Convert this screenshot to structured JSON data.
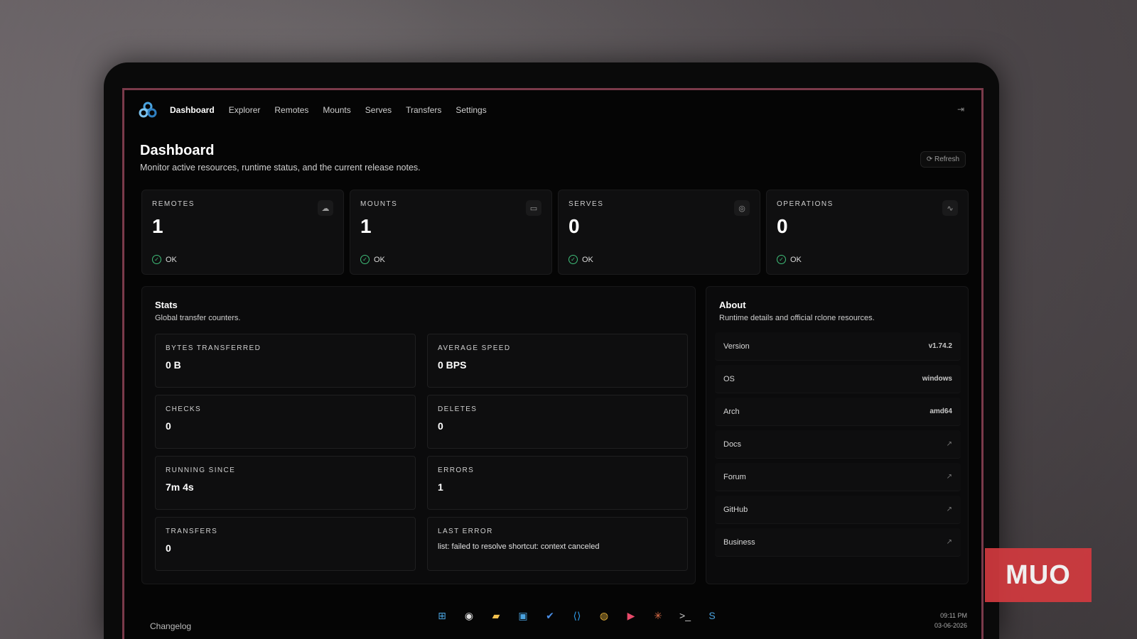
{
  "nav": {
    "items": [
      "Dashboard",
      "Explorer",
      "Remotes",
      "Mounts",
      "Serves",
      "Transfers",
      "Settings"
    ],
    "active": "Dashboard"
  },
  "header": {
    "title": "Dashboard",
    "subtitle": "Monitor active resources, runtime status, and the current release notes.",
    "refresh_label": "Refresh"
  },
  "cards": [
    {
      "label": "REMOTES",
      "value": "1",
      "status": "OK",
      "icon": "cloud-icon"
    },
    {
      "label": "MOUNTS",
      "value": "1",
      "status": "OK",
      "icon": "drive-icon"
    },
    {
      "label": "SERVES",
      "value": "0",
      "status": "OK",
      "icon": "globe-icon"
    },
    {
      "label": "OPERATIONS",
      "value": "0",
      "status": "OK",
      "icon": "activity-icon"
    }
  ],
  "stats": {
    "title": "Stats",
    "subtitle": "Global transfer counters.",
    "items": [
      {
        "label": "BYTES TRANSFERRED",
        "value": "0 B"
      },
      {
        "label": "AVERAGE SPEED",
        "value": "0 BPS"
      },
      {
        "label": "CHECKS",
        "value": "0"
      },
      {
        "label": "DELETES",
        "value": "0"
      },
      {
        "label": "RUNNING SINCE",
        "value": "7m 4s"
      },
      {
        "label": "ERRORS",
        "value": "1"
      },
      {
        "label": "TRANSFERS",
        "value": "0"
      },
      {
        "label": "LAST ERROR",
        "value": "list: failed to resolve shortcut: context canceled"
      }
    ]
  },
  "about": {
    "title": "About",
    "subtitle": "Runtime details and official rclone resources.",
    "rows": [
      {
        "label": "Version",
        "value": "v1.74.2"
      },
      {
        "label": "OS",
        "value": "windows"
      },
      {
        "label": "Arch",
        "value": "amd64"
      },
      {
        "label": "Docs",
        "value": ""
      },
      {
        "label": "Forum",
        "value": ""
      },
      {
        "label": "GitHub",
        "value": ""
      },
      {
        "label": "Business",
        "value": ""
      }
    ]
  },
  "changelog_label": "Changelog",
  "clock": {
    "time": "09:11 PM",
    "date": "03-06-2026"
  },
  "watermark": "MUO",
  "colors": {
    "accent_border": "#7a3a4a",
    "ok": "#3fc07a",
    "watermark": "#d23a3f"
  }
}
